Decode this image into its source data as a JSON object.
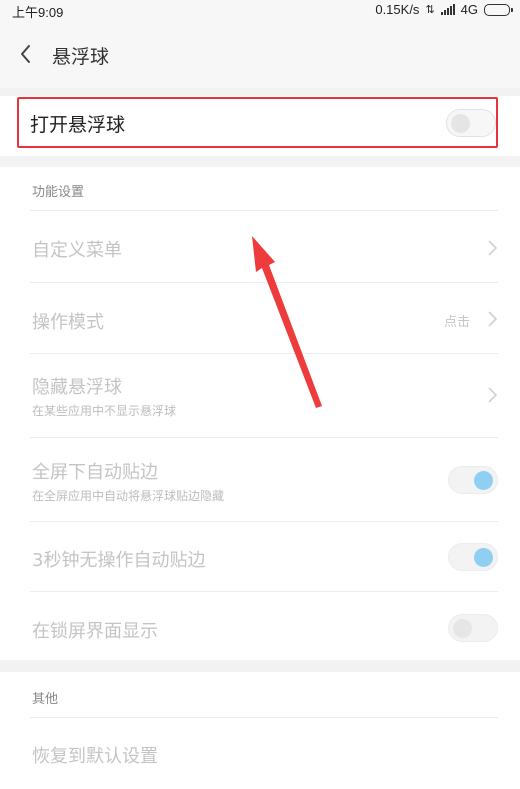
{
  "status_bar": {
    "time": "上午9:09",
    "speed": "0.15K/s",
    "network": "4G"
  },
  "header": {
    "title": "悬浮球"
  },
  "main_toggle": {
    "label": "打开悬浮球",
    "on": false
  },
  "function_section": {
    "title": "功能设置",
    "custom_menu": {
      "label": "自定义菜单"
    },
    "operation_mode": {
      "label": "操作模式",
      "value": "点击"
    },
    "hide_ball": {
      "label": "隐藏悬浮球",
      "sub": "在某些应用中不显示悬浮球"
    },
    "fullscreen_edge": {
      "label": "全屏下自动贴边",
      "sub": "在全屏应用中自动将悬浮球贴边隐藏",
      "on": true
    },
    "idle_edge": {
      "label": "3秒钟无操作自动贴边",
      "on": true
    },
    "lockscreen": {
      "label": "在锁屏界面显示",
      "on": false
    }
  },
  "other_section": {
    "title": "其他",
    "restore": {
      "label": "恢复到默认设置"
    }
  },
  "colors": {
    "highlight": "#e8323c",
    "toggle_on": "#8fd0f2",
    "arrow": "#ee3b3b"
  }
}
